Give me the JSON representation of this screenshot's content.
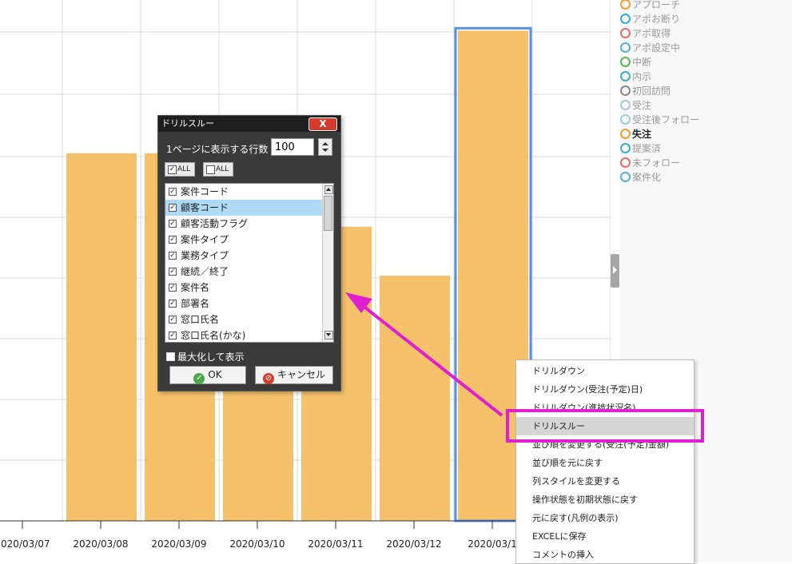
{
  "chart_data": {
    "type": "bar",
    "categories": [
      "2020/03/07",
      "2020/03/08",
      "2020/03/09",
      "2020/03/10",
      "2020/03/11",
      "2020/03/12",
      "2020/03/1"
    ],
    "values": [
      0,
      6,
      6,
      6,
      4.8,
      4,
      8
    ],
    "ylim": [
      0,
      8.5
    ],
    "grid": true,
    "bar_color": "#f5c26b",
    "selected_bar_border": "#5b8fe6",
    "title": "",
    "xlabel": "",
    "ylabel": ""
  },
  "legend": {
    "items": [
      {
        "label": "アプローチ",
        "color": "#f0a030"
      },
      {
        "label": "アポお断り",
        "color": "#3aa8d8"
      },
      {
        "label": "アポ取得",
        "color": "#e07070"
      },
      {
        "label": "アポ設定中",
        "color": "#5ab0c8"
      },
      {
        "label": "中断",
        "color": "#58b848"
      },
      {
        "label": "内示",
        "color": "#3ab0c8"
      },
      {
        "label": "初回訪問",
        "color": "#888888"
      },
      {
        "label": "受注",
        "color": "#a8c8d8"
      },
      {
        "label": "受注後フォロー",
        "color": "#9ad0d8"
      },
      {
        "label": "失注",
        "color": "#f0a030"
      },
      {
        "label": "提案済",
        "color": "#3ab0c8"
      },
      {
        "label": "未フォロー",
        "color": "#e07070"
      },
      {
        "label": "案件化",
        "color": "#5ab0c8"
      }
    ],
    "active_index": 9
  },
  "dialog": {
    "title": "ドリルスルー",
    "close_label": "X",
    "rows_label": "1ページに表示する行数",
    "rows_value": "100",
    "check_all_label": "ALL",
    "uncheck_all_label": "ALL",
    "fields": [
      {
        "label": "案件コード",
        "checked": true,
        "selected": false
      },
      {
        "label": "顧客コード",
        "checked": true,
        "selected": true
      },
      {
        "label": "顧客活動フラグ",
        "checked": true,
        "selected": false
      },
      {
        "label": "案件タイプ",
        "checked": true,
        "selected": false
      },
      {
        "label": "業務タイプ",
        "checked": true,
        "selected": false
      },
      {
        "label": "継続／終了",
        "checked": true,
        "selected": false
      },
      {
        "label": "案件名",
        "checked": true,
        "selected": false
      },
      {
        "label": "部署名",
        "checked": true,
        "selected": false
      },
      {
        "label": "窓口氏名",
        "checked": true,
        "selected": false
      },
      {
        "label": "窓口氏名(かな)",
        "checked": true,
        "selected": false
      }
    ],
    "maximize_label": "最大化して表示",
    "ok_label": "OK",
    "cancel_label": "キャンセル"
  },
  "context_menu": {
    "items": [
      {
        "label": "ドリルダウン"
      },
      {
        "label": "ドリルダウン(受注(予定)日)"
      },
      {
        "label": "ドリルダウン(進捗状況名)"
      },
      {
        "label": "ドリルスルー",
        "highlighted": true
      },
      {
        "label": "並び順を変更する(受注(予定)金額)"
      },
      {
        "label": "並び順を元に戻す"
      },
      {
        "label": "列スタイルを変更する"
      },
      {
        "label": "操作状態を初期状態に戻す"
      },
      {
        "label": "元に戻す(凡例の表示)"
      },
      {
        "label": "EXCELに保存"
      },
      {
        "label": "コメントの挿入"
      }
    ]
  },
  "annotation_color": "#e020d0"
}
